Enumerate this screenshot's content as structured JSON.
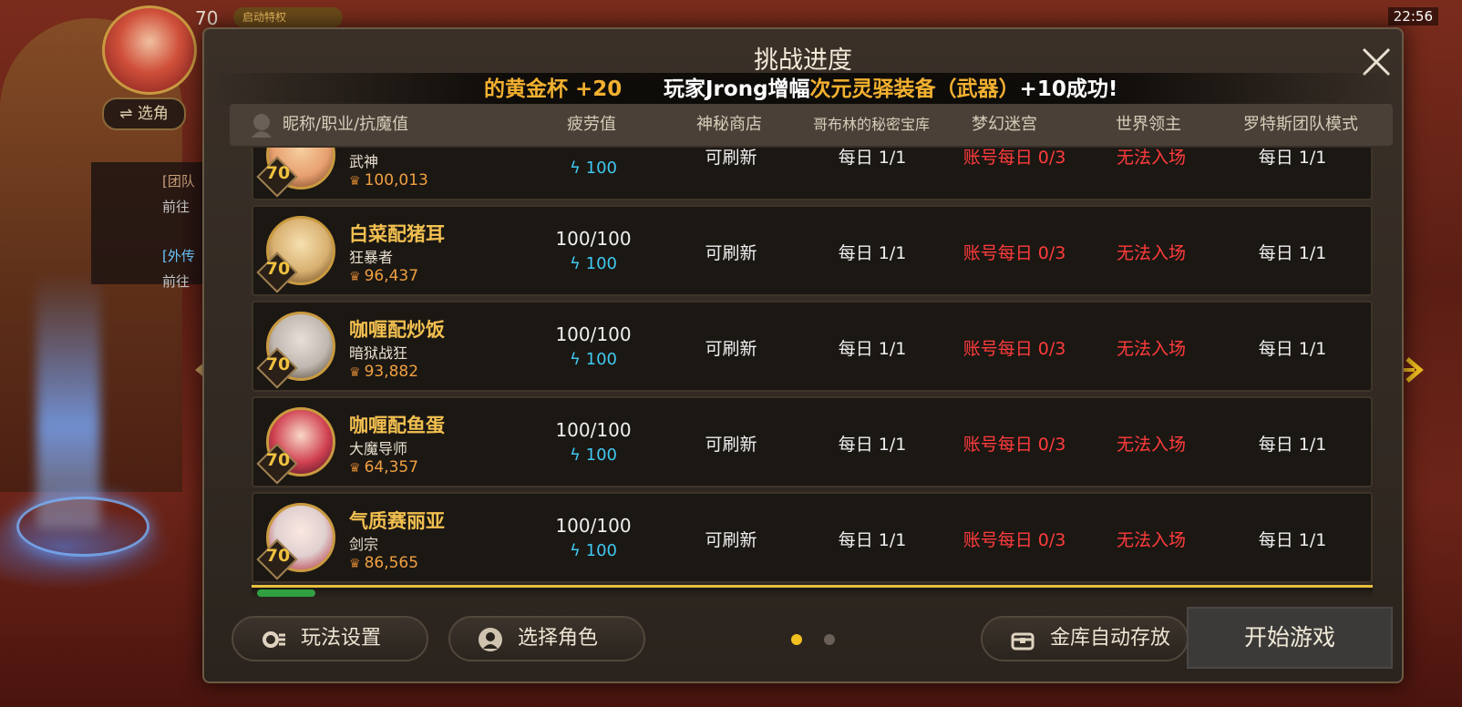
{
  "background": {
    "level": "70",
    "tag": "启动特权",
    "switch_role": "⇌ 选角",
    "chat": [
      "[团队",
      "前往",
      "[外传",
      "前往"
    ],
    "time": "22:56"
  },
  "modal": {
    "title": "挑战进度",
    "banner_left": "的黄金杯 +20",
    "banner_main_prefix": "玩家Jrong增幅",
    "banner_main_highlight": "次元灵驿装备（武器）",
    "banner_main_suffix": "+10成功!",
    "columns": [
      "昵称/职业/抗魔值",
      "疲劳值",
      "神秘商店",
      "哥布林的秘密宝库",
      "梦幻迷宫",
      "世界领主",
      "罗特斯团队模式"
    ],
    "rows": [
      {
        "name": "",
        "job": "武神",
        "level": "70",
        "power": "100,013",
        "fatigue": "",
        "fatigue_energy": "100",
        "shop": "可刷新",
        "goblin": "每日 1/1",
        "dream": "账号每日 0/3",
        "boss": "无法入场",
        "raid": "每日 1/1",
        "avatar_color": "#e8a070"
      },
      {
        "name": "白菜配猪耳",
        "job": "狂暴者",
        "level": "70",
        "power": "96,437",
        "fatigue": "100/100",
        "fatigue_energy": "100",
        "shop": "可刷新",
        "goblin": "每日 1/1",
        "dream": "账号每日 0/3",
        "boss": "无法入场",
        "raid": "每日 1/1",
        "avatar_color": "#d8b070"
      },
      {
        "name": "咖喱配炒饭",
        "job": "暗狱战狂",
        "level": "70",
        "power": "93,882",
        "fatigue": "100/100",
        "fatigue_energy": "100",
        "shop": "可刷新",
        "goblin": "每日 1/1",
        "dream": "账号每日 0/3",
        "boss": "无法入场",
        "raid": "每日 1/1",
        "avatar_color": "#c0b8b0"
      },
      {
        "name": "咖喱配鱼蛋",
        "job": "大魔导师",
        "level": "70",
        "power": "64,357",
        "fatigue": "100/100",
        "fatigue_energy": "100",
        "shop": "可刷新",
        "goblin": "每日 1/1",
        "dream": "账号每日 0/3",
        "boss": "无法入场",
        "raid": "每日 1/1",
        "avatar_color": "#d04050"
      },
      {
        "name": "气质赛丽亚",
        "job": "剑宗",
        "level": "70",
        "power": "86,565",
        "fatigue": "100/100",
        "fatigue_energy": "100",
        "shop": "可刷新",
        "goblin": "每日 1/1",
        "dream": "账号每日 0/3",
        "boss": "无法入场",
        "raid": "每日 1/1",
        "avatar_color": "#e0d0d0"
      }
    ],
    "buttons": {
      "settings": "玩法设置",
      "select_role": "选择角色",
      "vault": "金库自动存放",
      "start": "开始游戏"
    },
    "pager": {
      "current": 1,
      "total": 2
    },
    "colors": {
      "accent": "#f2b030",
      "red": "#ff3c3c",
      "energy": "#40c8f0"
    }
  }
}
